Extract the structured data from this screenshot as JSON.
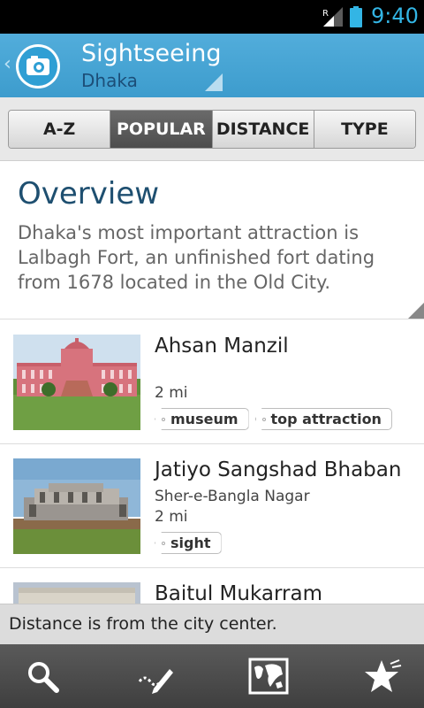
{
  "status_bar": {
    "time": "9:40",
    "network_indicator": "R",
    "accent_color": "#33b5e5"
  },
  "action_bar": {
    "title": "Sightseeing",
    "subtitle": "Dhaka",
    "logo_icon": "camera-icon",
    "back_icon": "chevron-left-icon",
    "background_color": "#4aa6d6"
  },
  "tabs": [
    {
      "label": "A-Z",
      "selected": false
    },
    {
      "label": "POPULAR",
      "selected": true
    },
    {
      "label": "DISTANCE",
      "selected": false
    },
    {
      "label": "TYPE",
      "selected": false
    }
  ],
  "overview": {
    "heading": "Overview",
    "body": "Dhaka's most important attraction is Lalbagh Fort, an unfinished fort dating from 1678 located in the Old City."
  },
  "list": [
    {
      "name": "Ahsan Manzil",
      "area": "",
      "distance": "2 mi",
      "tags": [
        "museum",
        "top attraction"
      ]
    },
    {
      "name": "Jatiyo Sangshad Bhaban",
      "area": "Sher-e-Bangla Nagar",
      "distance": "2 mi",
      "tags": [
        "sight"
      ]
    },
    {
      "name": "Baitul Mukarram",
      "area": "",
      "distance": "",
      "tags": []
    }
  ],
  "notice": {
    "text": "Distance is from the city center."
  },
  "bottom_nav": [
    {
      "icon": "search-icon"
    },
    {
      "icon": "edit-icon"
    },
    {
      "icon": "map-icon"
    },
    {
      "icon": "favorites-icon"
    }
  ]
}
